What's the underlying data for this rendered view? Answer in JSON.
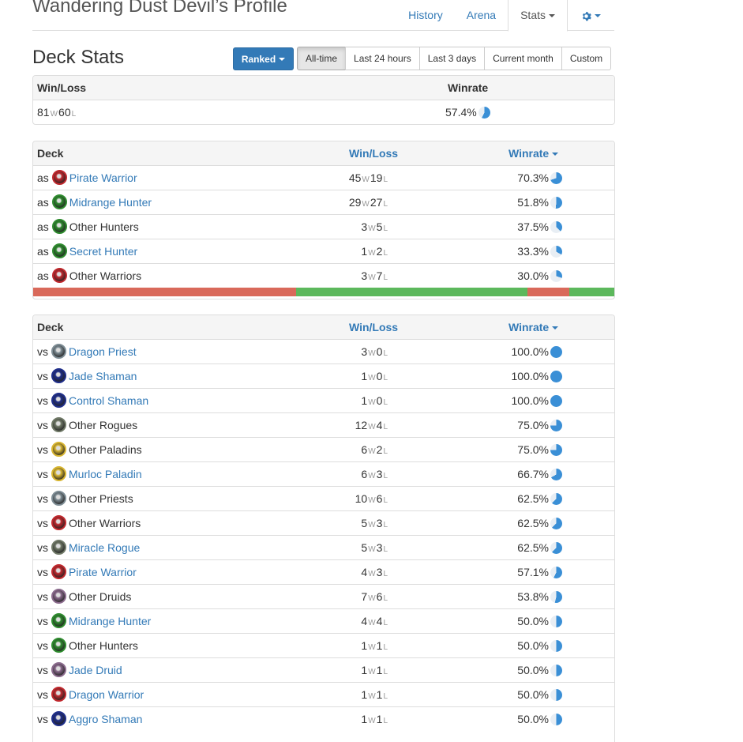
{
  "header": {
    "title": "Wandering Dust Devil’s Profile",
    "nav": [
      "History",
      "Arena",
      "Stats"
    ],
    "active_nav": "Stats",
    "settings_icon": "gear-icon"
  },
  "deck_stats": {
    "title": "Deck Stats",
    "mode_button": "Ranked",
    "periods": [
      "All-time",
      "Last 24 hours",
      "Last 3 days",
      "Current month",
      "Custom"
    ],
    "active_period": "All-time"
  },
  "summary": {
    "col_winloss": "Win/Loss",
    "col_winrate": "Winrate",
    "wins": "81",
    "losses": "60",
    "winrate": "57.4%",
    "winrate_value": 0.574
  },
  "labels": {
    "w": "W",
    "l": "L"
  },
  "as_table": {
    "col_deck": "Deck",
    "col_winloss": "Win/Loss",
    "col_winrate": "Winrate",
    "rows": [
      {
        "prefix": "as",
        "name": "Pirate Warrior",
        "link": true,
        "class": "warrior",
        "wins": "45",
        "losses": "19",
        "winrate": "70.3%",
        "rate": 0.703
      },
      {
        "prefix": "as",
        "name": "Midrange Hunter",
        "link": true,
        "class": "hunter",
        "wins": "29",
        "losses": "27",
        "winrate": "51.8%",
        "rate": 0.518
      },
      {
        "prefix": "as",
        "name": "Other Hunters",
        "link": false,
        "class": "hunter",
        "wins": "3",
        "losses": "5",
        "winrate": "37.5%",
        "rate": 0.375
      },
      {
        "prefix": "as",
        "name": "Secret Hunter",
        "link": true,
        "class": "hunter",
        "wins": "1",
        "losses": "2",
        "winrate": "33.3%",
        "rate": 0.333
      },
      {
        "prefix": "as",
        "name": "Other Warriors",
        "link": false,
        "class": "warrior",
        "wins": "3",
        "losses": "7",
        "winrate": "30.0%",
        "rate": 0.3
      }
    ],
    "bar_segments": [
      {
        "share": 0.453,
        "color": "#d9695a"
      },
      {
        "share": 0.398,
        "color": "#5cb85c"
      },
      {
        "share": 0.071,
        "color": "#d9695a"
      },
      {
        "share": 0.078,
        "color": "#5cb85c"
      }
    ]
  },
  "vs_table": {
    "col_deck": "Deck",
    "col_winloss": "Win/Loss",
    "col_winrate": "Winrate",
    "rows": [
      {
        "prefix": "vs",
        "name": "Dragon Priest",
        "link": true,
        "class": "priest",
        "wins": "3",
        "losses": "0",
        "winrate": "100.0%",
        "rate": 1.0
      },
      {
        "prefix": "vs",
        "name": "Jade Shaman",
        "link": true,
        "class": "shaman",
        "wins": "1",
        "losses": "0",
        "winrate": "100.0%",
        "rate": 1.0
      },
      {
        "prefix": "vs",
        "name": "Control Shaman",
        "link": true,
        "class": "shaman",
        "wins": "1",
        "losses": "0",
        "winrate": "100.0%",
        "rate": 1.0
      },
      {
        "prefix": "vs",
        "name": "Other Rogues",
        "link": false,
        "class": "rogue",
        "wins": "12",
        "losses": "4",
        "winrate": "75.0%",
        "rate": 0.75
      },
      {
        "prefix": "vs",
        "name": "Other Paladins",
        "link": false,
        "class": "paladin",
        "wins": "6",
        "losses": "2",
        "winrate": "75.0%",
        "rate": 0.75
      },
      {
        "prefix": "vs",
        "name": "Murloc Paladin",
        "link": true,
        "class": "paladin",
        "wins": "6",
        "losses": "3",
        "winrate": "66.7%",
        "rate": 0.667
      },
      {
        "prefix": "vs",
        "name": "Other Priests",
        "link": false,
        "class": "priest",
        "wins": "10",
        "losses": "6",
        "winrate": "62.5%",
        "rate": 0.625
      },
      {
        "prefix": "vs",
        "name": "Other Warriors",
        "link": false,
        "class": "warrior",
        "wins": "5",
        "losses": "3",
        "winrate": "62.5%",
        "rate": 0.625
      },
      {
        "prefix": "vs",
        "name": "Miracle Rogue",
        "link": true,
        "class": "rogue",
        "wins": "5",
        "losses": "3",
        "winrate": "62.5%",
        "rate": 0.625
      },
      {
        "prefix": "vs",
        "name": "Pirate Warrior",
        "link": true,
        "class": "warrior",
        "wins": "4",
        "losses": "3",
        "winrate": "57.1%",
        "rate": 0.571
      },
      {
        "prefix": "vs",
        "name": "Other Druids",
        "link": false,
        "class": "druid",
        "wins": "7",
        "losses": "6",
        "winrate": "53.8%",
        "rate": 0.538
      },
      {
        "prefix": "vs",
        "name": "Midrange Hunter",
        "link": true,
        "class": "hunter",
        "wins": "4",
        "losses": "4",
        "winrate": "50.0%",
        "rate": 0.5
      },
      {
        "prefix": "vs",
        "name": "Other Hunters",
        "link": false,
        "class": "hunter",
        "wins": "1",
        "losses": "1",
        "winrate": "50.0%",
        "rate": 0.5
      },
      {
        "prefix": "vs",
        "name": "Jade Druid",
        "link": true,
        "class": "druid",
        "wins": "1",
        "losses": "1",
        "winrate": "50.0%",
        "rate": 0.5
      },
      {
        "prefix": "vs",
        "name": "Dragon Warrior",
        "link": true,
        "class": "warrior",
        "wins": "1",
        "losses": "1",
        "winrate": "50.0%",
        "rate": 0.5
      },
      {
        "prefix": "vs",
        "name": "Aggro Shaman",
        "link": true,
        "class": "shaman",
        "wins": "1",
        "losses": "1",
        "winrate": "50.0%",
        "rate": 0.5
      }
    ]
  },
  "colors": {
    "link": "#337ab7",
    "pie_fill": "#3a8fd6",
    "pie_bg": "#e8eef4",
    "loss_bar": "#d9695a",
    "win_bar": "#5cb85c",
    "class_warrior": "#c0282d",
    "class_hunter": "#2e8b2e",
    "class_priest": "#7d8c94",
    "class_shaman": "#1f2e8a",
    "class_rogue": "#6f7866",
    "class_paladin": "#d8b530",
    "class_druid": "#8a6a8c"
  }
}
